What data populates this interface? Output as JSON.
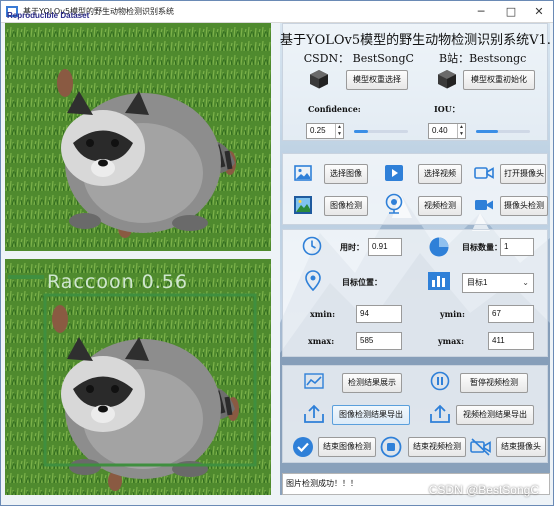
{
  "window": {
    "title": "基于YOLOv5模型的野生动物检测识别系统",
    "watermark": "Reproducible Dataset"
  },
  "detection_box": {
    "label": "Raccoon 0.56"
  },
  "header": {
    "app_title": "基于YOLOv5模型的野生动物检测识别系统V1.0",
    "csdn": "CSDN：  BestSongC",
    "bilibili": "B站：Bestsongc"
  },
  "model": {
    "select_weights": "模型权重选择",
    "init_weights": "模型权重初始化"
  },
  "params": {
    "confidence_label": "Confidence:",
    "confidence_value": "0.25",
    "confidence_level": 0.25,
    "iou_label": "IOU：",
    "iou_value": "0.40",
    "iou_level": 0.4
  },
  "input": {
    "select_image": "选择图像",
    "select_video": "选择视频",
    "open_camera": "打开摄像头",
    "image_detect": "图像检测",
    "video_detect": "视频检测",
    "camera_detect": "摄像头检测"
  },
  "results": {
    "time_label": "用时：",
    "time_value": "0.91",
    "count_label": "目标数量：",
    "count_value": "1",
    "position_label": "目标位置：",
    "target_selected": "目标1",
    "xmin_label": "xmin:",
    "xmin_value": "94",
    "ymin_label": "ymin:",
    "ymin_value": "67",
    "xmax_label": "xmax:",
    "xmax_value": "585",
    "ymax_label": "ymax:",
    "ymax_value": "411"
  },
  "actions": {
    "show_results": "检测结果展示",
    "pause_video": "暂停视频检测",
    "export_image": "图像检测结果导出",
    "export_video": "视频检测结果导出",
    "stop_image": "结束图像检测",
    "stop_video": "结束视频检测",
    "stop_camera": "结束摄像头"
  },
  "status": {
    "message": "图片检测成功！！！"
  },
  "footer": {
    "watermark": "CSDN @BestSongC"
  },
  "colors": {
    "accent": "#2f80d8",
    "detect_box": "#3f8f3f"
  },
  "icons": [
    "app-icon",
    "cube-icon",
    "image-icon",
    "play-icon",
    "camera-icon",
    "photo-icon",
    "webcam-icon",
    "video-camera-icon",
    "clock-icon",
    "pie-chart-icon",
    "location-pin-icon",
    "bar-chart-icon",
    "line-chart-icon",
    "pause-icon",
    "upload-icon",
    "check-icon",
    "stop-icon",
    "camera-off-icon"
  ]
}
